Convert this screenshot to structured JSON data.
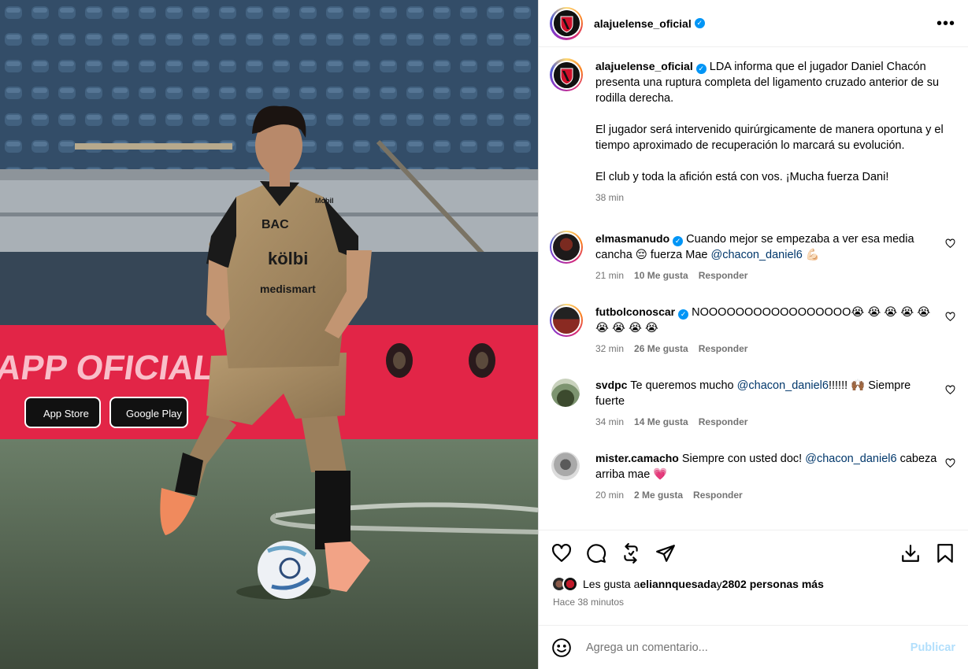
{
  "post": {
    "author": "alajuelense_oficial",
    "more_label": "•••",
    "caption_paragraphs": [
      "LDA informa que el jugador Daniel Chacón presenta una ruptura completa del ligamento cruzado anterior de su rodilla derecha.",
      "El jugador será intervenido quirúrgicamente de manera oportuna y el tiempo aproximado de recuperación lo marcará su evolución.",
      "El club y toda la afición está con vos. ¡Mucha fuerza Dani!"
    ],
    "caption_time": "38 min",
    "photo_texts": {
      "banner": "A APP OFICIAL DE L",
      "sponsor_bac": "BAC",
      "sponsor_kolbi": "kölbi",
      "sponsor_medismart": "medismart",
      "sponsor_mobil": "Mobil",
      "app_store": "App Store",
      "google_play": "Google Play"
    }
  },
  "comments": [
    {
      "user": "elmasmanudo",
      "verified": true,
      "text_before": "Cuando mejor se empezaba a ver esa media cancha 😔  fuerza Mae ",
      "mention": "@chacon_daniel6",
      "text_after": " 💪🏻",
      "time": "21 min",
      "likes": "10 Me gusta",
      "reply": "Responder"
    },
    {
      "user": "futbolconoscar",
      "verified": true,
      "text_before": "NOOOOOOOOOOOOOOOOO😭 😭 😭 😭 😭 😭 😭 😭 😭",
      "mention": "",
      "text_after": "",
      "time": "32 min",
      "likes": "26 Me gusta",
      "reply": "Responder"
    },
    {
      "user": "svdpc",
      "verified": false,
      "text_before": "Te queremos mucho ",
      "mention": "@chacon_daniel6",
      "text_after": "!!!!!! 🙌🏾  Siempre fuerte",
      "time": "34 min",
      "likes": "14 Me gusta",
      "reply": "Responder"
    },
    {
      "user": "mister.camacho",
      "verified": false,
      "text_before": "Siempre con usted doc! ",
      "mention": "@chacon_daniel6",
      "text_after": " cabeza arriba mae 💗",
      "time": "20 min",
      "likes": "2 Me gusta",
      "reply": "Responder"
    }
  ],
  "likes_summary": {
    "prefix": "Les gusta a ",
    "user": "eliannquesada",
    "middle": " y ",
    "others": "2802 personas más",
    "ago": "Hace 38 minutos"
  },
  "composer": {
    "placeholder": "Agrega un comentario...",
    "publish": "Publicar"
  },
  "icons": {
    "header": [
      "verified-icon",
      "more-options-icon"
    ],
    "actions": [
      "heart-icon",
      "comment-icon",
      "repost-icon",
      "share-icon",
      "download-icon",
      "bookmark-icon"
    ],
    "composer": [
      "emoji-icon"
    ]
  },
  "colors": {
    "verified": "#0095f6",
    "mention": "#00376b",
    "publish_disabled": "#b2dffc",
    "muted": "#737373",
    "jersey": "#a58a62",
    "banner": "#e3203f"
  }
}
